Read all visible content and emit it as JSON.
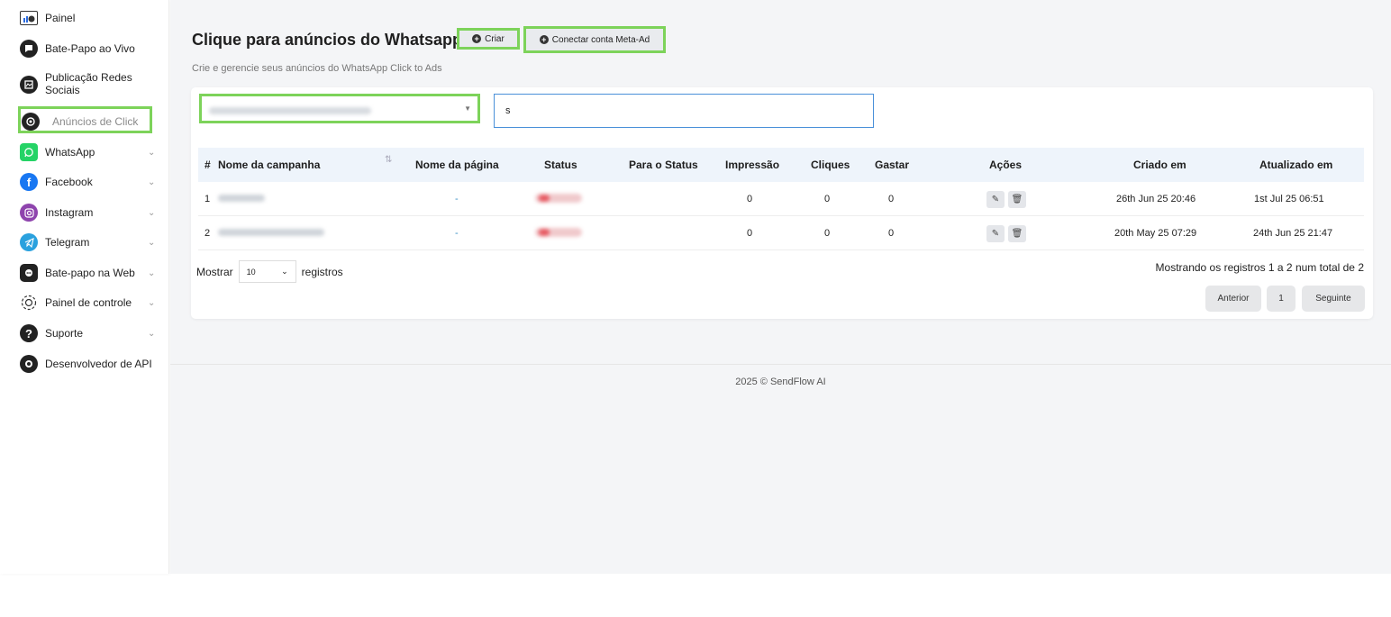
{
  "sidebar": {
    "items": [
      {
        "label": "Painel",
        "icon": "dashboard-icon"
      },
      {
        "label": "Bate-Papo ao Vivo",
        "icon": "live-chat-icon"
      },
      {
        "label": "Publicação Redes",
        "label2": "Sociais",
        "icon": "social-post-icon"
      },
      {
        "label": "Anúncios de Click",
        "icon": "click-ads-icon"
      },
      {
        "label": "WhatsApp",
        "icon": "whatsapp-icon",
        "chevron": "⌄"
      },
      {
        "label": "Facebook",
        "icon": "facebook-icon",
        "chevron": "⌄"
      },
      {
        "label": "Instagram",
        "icon": "instagram-icon",
        "chevron": "⌄"
      },
      {
        "label": "Telegram",
        "icon": "telegram-icon",
        "chevron": "⌄"
      },
      {
        "label": "Bate-papo na Web",
        "icon": "web-chat-icon",
        "chevron": "⌄"
      },
      {
        "label": "Painel de controle",
        "icon": "gear-icon",
        "chevron": "⌄"
      },
      {
        "label": "Suporte",
        "icon": "help-icon",
        "chevron": "⌄"
      },
      {
        "label": "Desenvolvedor de API",
        "icon": "api-icon"
      }
    ]
  },
  "header": {
    "title": "Clique para anúncios do Whatsapp",
    "create_label": "Criar",
    "connect_label": "Conectar conta Meta-Ad",
    "subtitle": "Crie e gerencie seus anúncios do WhatsApp Click to Ads"
  },
  "filters": {
    "search_value": "s"
  },
  "table": {
    "columns": [
      "#",
      "Nome da campanha",
      "Nome da página",
      "Status",
      "Para o Status",
      "Impressão",
      "Cliques",
      "Gastar",
      "Ações",
      "Criado em",
      "Atualizado em"
    ],
    "rows": [
      {
        "num": "1",
        "page": "-",
        "impressions": "0",
        "clicks": "0",
        "spend": "0",
        "created": "26th Jun 25 20:46",
        "updated": "1st Jul 25 06:51"
      },
      {
        "num": "2",
        "page": "-",
        "impressions": "0",
        "clicks": "0",
        "spend": "0",
        "created": "20th May 25 07:29",
        "updated": "24th Jun 25 21:47"
      }
    ]
  },
  "footer_controls": {
    "show_label": "Mostrar",
    "page_length": "10",
    "records_label": "registros",
    "info": "Mostrando os registros 1 a 2 num total de 2",
    "prev": "Anterior",
    "page": "1",
    "next": "Seguinte"
  },
  "copyright": "2025 © SendFlow AI",
  "colors": {
    "highlight": "#7dd35a",
    "whatsapp": "#25d366",
    "facebook": "#1877f2",
    "instagram": "#8e44ad",
    "telegram": "#2aa1de"
  }
}
